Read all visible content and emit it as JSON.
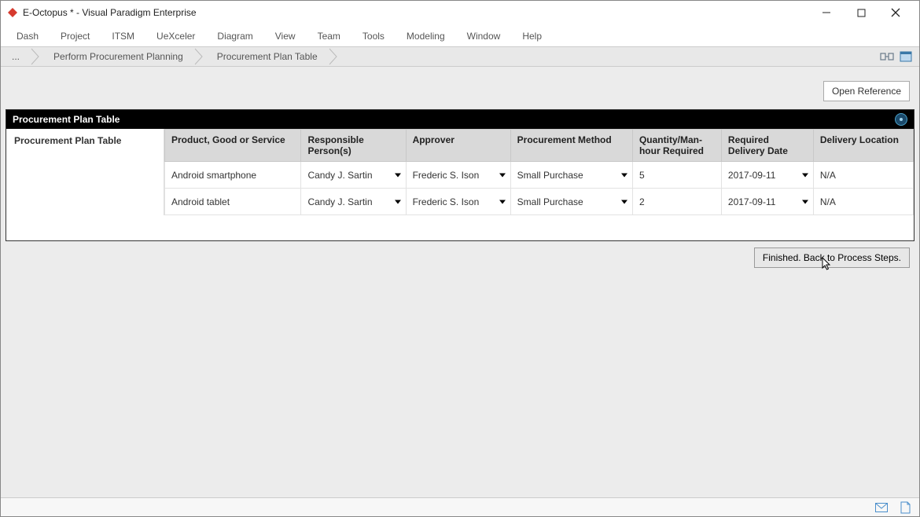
{
  "window": {
    "title": "E-Octopus * - Visual Paradigm Enterprise"
  },
  "menu": [
    "Dash",
    "Project",
    "ITSM",
    "UeXceler",
    "Diagram",
    "View",
    "Team",
    "Tools",
    "Modeling",
    "Window",
    "Help"
  ],
  "breadcrumb": {
    "root": "...",
    "items": [
      "Perform Procurement Planning",
      "Procurement Plan Table"
    ]
  },
  "actions": {
    "openReference": "Open Reference",
    "finished": "Finished. Back to Process Steps."
  },
  "panel": {
    "title": "Procurement Plan Table",
    "sideLabel": "Procurement Plan Table"
  },
  "table": {
    "headers": {
      "product": "Product, Good or Service",
      "responsible": "Responsible Person(s)",
      "approver": "Approver",
      "method": "Procurement Method",
      "quantity": "Quantity/Man-hour Required",
      "date": "Required Delivery Date",
      "location": "Delivery Location"
    },
    "rows": [
      {
        "product": "Android smartphone",
        "responsible": "Candy J. Sartin",
        "approver": "Frederic S. Ison",
        "method": "Small Purchase",
        "quantity": "5",
        "date": "2017-09-11",
        "location": "N/A"
      },
      {
        "product": "Android tablet",
        "responsible": "Candy J. Sartin",
        "approver": "Frederic S. Ison",
        "method": "Small Purchase",
        "quantity": "2",
        "date": "2017-09-11",
        "location": "N/A"
      }
    ]
  }
}
